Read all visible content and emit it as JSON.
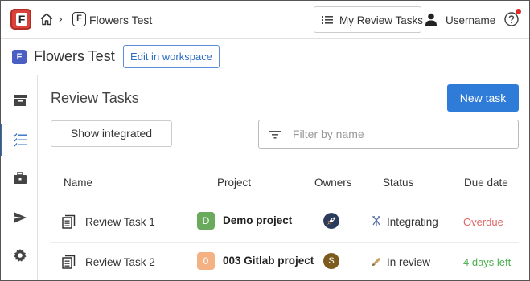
{
  "app": {
    "logo_letter": "F"
  },
  "breadcrumb": {
    "project_icon_letter": "F",
    "project_label": "Flowers Test"
  },
  "topbar": {
    "my_review_tasks_label": "My Review Tasks",
    "username": "Username"
  },
  "project_header": {
    "badge_letter": "F",
    "title": "Flowers Test",
    "edit_button_label": "Edit in workspace"
  },
  "main": {
    "title": "Review Tasks",
    "new_task_label": "New task",
    "show_integrated_label": "Show integrated",
    "filter_placeholder": "Filter by name",
    "filter_value": ""
  },
  "table": {
    "columns": [
      "Name",
      "Project",
      "Owners",
      "Status",
      "Due date"
    ],
    "rows": [
      {
        "name": "Review Task 1",
        "project_letter": "D",
        "project_color": "#6aaa5c",
        "project": "Demo project",
        "owner_avatar": "rocket-icon",
        "owner_color": "#2a3b5c",
        "status_icon": "merge-icon",
        "status": "Integrating",
        "due": "Overdue",
        "due_color": "#e06565"
      },
      {
        "name": "Review Task 2",
        "project_letter": "0",
        "project_color": "#f4b183",
        "project": "003 Gitlab project",
        "owner_letter": "S",
        "owner_color": "#7d5b1e",
        "status_icon": "pencil-icon",
        "status": "In review",
        "due": "4 days left",
        "due_color": "#4caf50"
      }
    ]
  },
  "colors": {
    "accent": "#2f7bd8",
    "logo": "#d9423a",
    "notification": "#e02b2b"
  }
}
